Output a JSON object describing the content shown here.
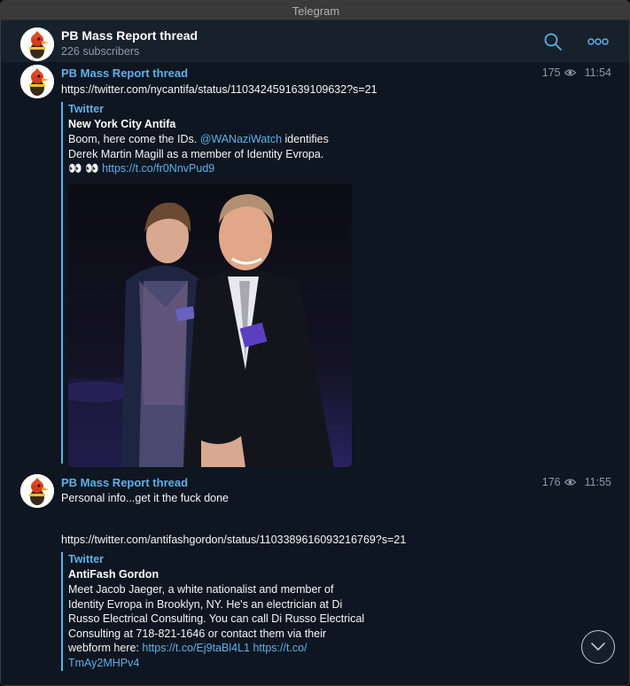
{
  "window": {
    "title": "Telegram"
  },
  "header": {
    "channel_name": "PB Mass Report thread",
    "subscribers": "226 subscribers",
    "search_icon": "search-icon",
    "more_icon": "more-icon"
  },
  "messages": [
    {
      "sender": "PB Mass Report thread",
      "views": "175",
      "time": "11:54",
      "link": "https://twitter.com/nycantifa/status/1103424591639109632?s=21",
      "preview": {
        "site": "Twitter",
        "title": "New York City Antifa",
        "desc_before_mention": "Boom, here come the IDs. ",
        "mention": "@WANaziWatch",
        "desc_after_mention": " identifies\nDerek Martin Magill as a member of Identity Evropa.",
        "emoji": "👀 👀 ",
        "short_link": "https://t.co/fr0NnvPud9",
        "photo_icon": "photo-image"
      }
    },
    {
      "sender": "PB Mass Report thread",
      "views": "176",
      "time": "11:55",
      "text": "Personal info...get it the fuck done",
      "link": "https://twitter.com/antifashgordon/status/1103389616093216769?s=21",
      "preview": {
        "site": "Twitter",
        "title": "AntiFash Gordon",
        "desc": "Meet Jacob Jaeger, a white nationalist and member of\nIdentity Evropa in Brooklyn, NY. He's an electrician at Di\nRusso Electrical Consulting. You can call Di Russo Electrical\nConsulting at 718-821-1646 or contact them via their\nwebform here: ",
        "link1": "https://t.co/Ej9taBl4L1",
        "link2_a": " https://t.co/",
        "link2_b": "TmAy2MHPv4"
      }
    }
  ],
  "scroll_icon": "chevron-down-icon",
  "colors": {
    "accent": "#5fb0e8",
    "background": "#0e1621",
    "header": "#17212b"
  }
}
